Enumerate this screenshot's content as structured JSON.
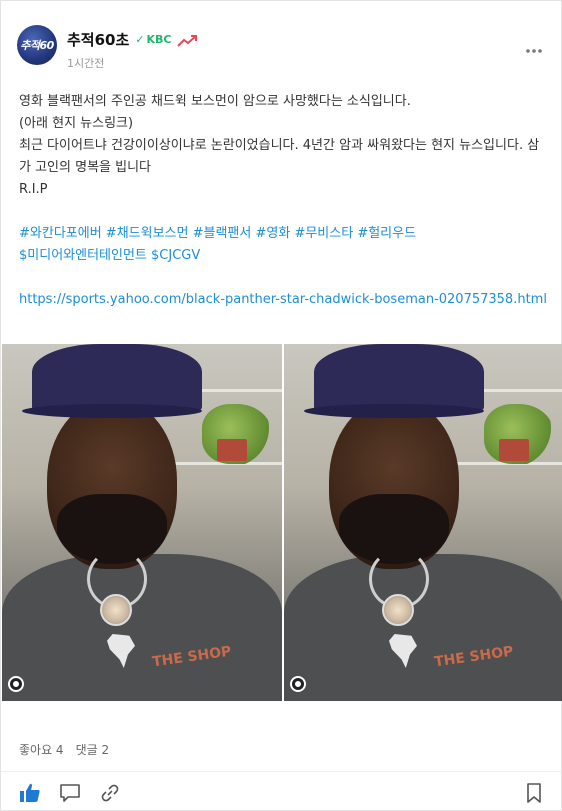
{
  "author": {
    "name": "추적60초",
    "avatar_text": "추적60",
    "badge_label": "KBC",
    "timestamp": "1시간전"
  },
  "post": {
    "lines": [
      "영화 블랙팬서의 주인공 채드윅 보스먼이 암으로 사망했다는 소식입니다.",
      "(아래 현지 뉴스링크)",
      "최근 다이어트냐 건강이이상이냐로 논란이었습니다. 4년간 암과 싸워왔다는 현지 뉴스입니다. 삼가 고인의 명복을 빕니다",
      "R.I.P"
    ],
    "hashtags_line1": [
      "#와칸다포에버",
      "#채드윅보스먼",
      "#블랙팬서",
      "#영화",
      "#무비스타",
      "#헐리우드"
    ],
    "hashtags_line2": [
      "$미디어와엔터테인먼트",
      "$CJCGV"
    ],
    "link": "https://sports.yahoo.com/black-panther-star-chadwick-boseman-020757358.html"
  },
  "media": {
    "shop_text": "THE SHOP"
  },
  "stats": {
    "likes": "좋아요 4",
    "comments": "댓글 2"
  },
  "colors": {
    "accent": "#1b8fd8",
    "badge_green": "#1eb86e",
    "like_blue": "#1f7ad6",
    "trend_red": "#e8485c"
  },
  "icons": {
    "more": "more-icon",
    "like": "thumbs-up-icon",
    "comment": "comment-icon",
    "share": "link-icon",
    "bookmark": "bookmark-icon"
  }
}
